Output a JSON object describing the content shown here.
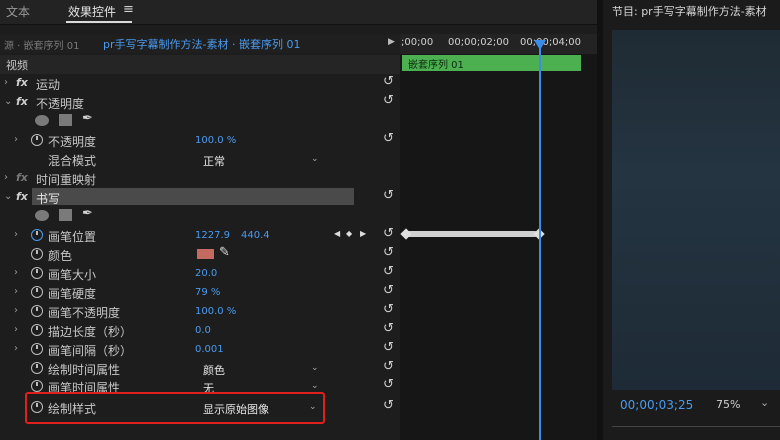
{
  "tabs": {
    "text_label": "文本",
    "effects_label": "效果控件",
    "menu_icon": "hamburger-icon"
  },
  "source": {
    "label": "源 · 嵌套序列 01",
    "sequence": "pr手写字幕制作方法-素材 · 嵌套序列 01",
    "arrow": "▶"
  },
  "timeline": {
    "tc1": ";00;00",
    "tc2": "00;00;02;00",
    "tc3": "00;00;04;00",
    "clip_name": "嵌套序列 01"
  },
  "panel": {
    "video_header": "视频"
  },
  "motion": {
    "label": "运动"
  },
  "opacity": {
    "label": "不透明度",
    "param_label": "不透明度",
    "param_value": "100.0 %",
    "blend_label": "混合模式",
    "blend_value": "正常"
  },
  "time_remap": {
    "label": "时间重映射"
  },
  "write": {
    "label": "书写",
    "brush_pos_label": "画笔位置",
    "brush_pos_x": "1227.9",
    "brush_pos_y": "440.4",
    "color_label": "颜色",
    "color_hex": "#c56a5f",
    "size_label": "画笔大小",
    "size_value": "20.0",
    "hardness_label": "画笔硬度",
    "hardness_value": "79 %",
    "opacity_label": "画笔不透明度",
    "opacity_value": "100.0 %",
    "stroke_len_label": "描边长度（秒）",
    "stroke_len_value": "0.0",
    "spacing_label": "画笔间隔（秒）",
    "spacing_value": "0.001",
    "paint_time_label": "绘制时间属性",
    "paint_time_value": "颜色",
    "brush_time_label": "画笔时间属性",
    "brush_time_value": "无",
    "paint_style_label": "绘制样式",
    "paint_style_value": "显示原始图像"
  },
  "keyframe_nav": {
    "prev": "◀",
    "add": "◆",
    "next": "▶"
  },
  "monitor": {
    "title": "节目: pr手写字幕制作方法-素材",
    "timecode": "00;00;03;25",
    "zoom": "75%"
  },
  "colors": {
    "accent_blue": "#4a9bf0",
    "clip_green": "#4caf50",
    "highlight_red": "#e0201f"
  }
}
